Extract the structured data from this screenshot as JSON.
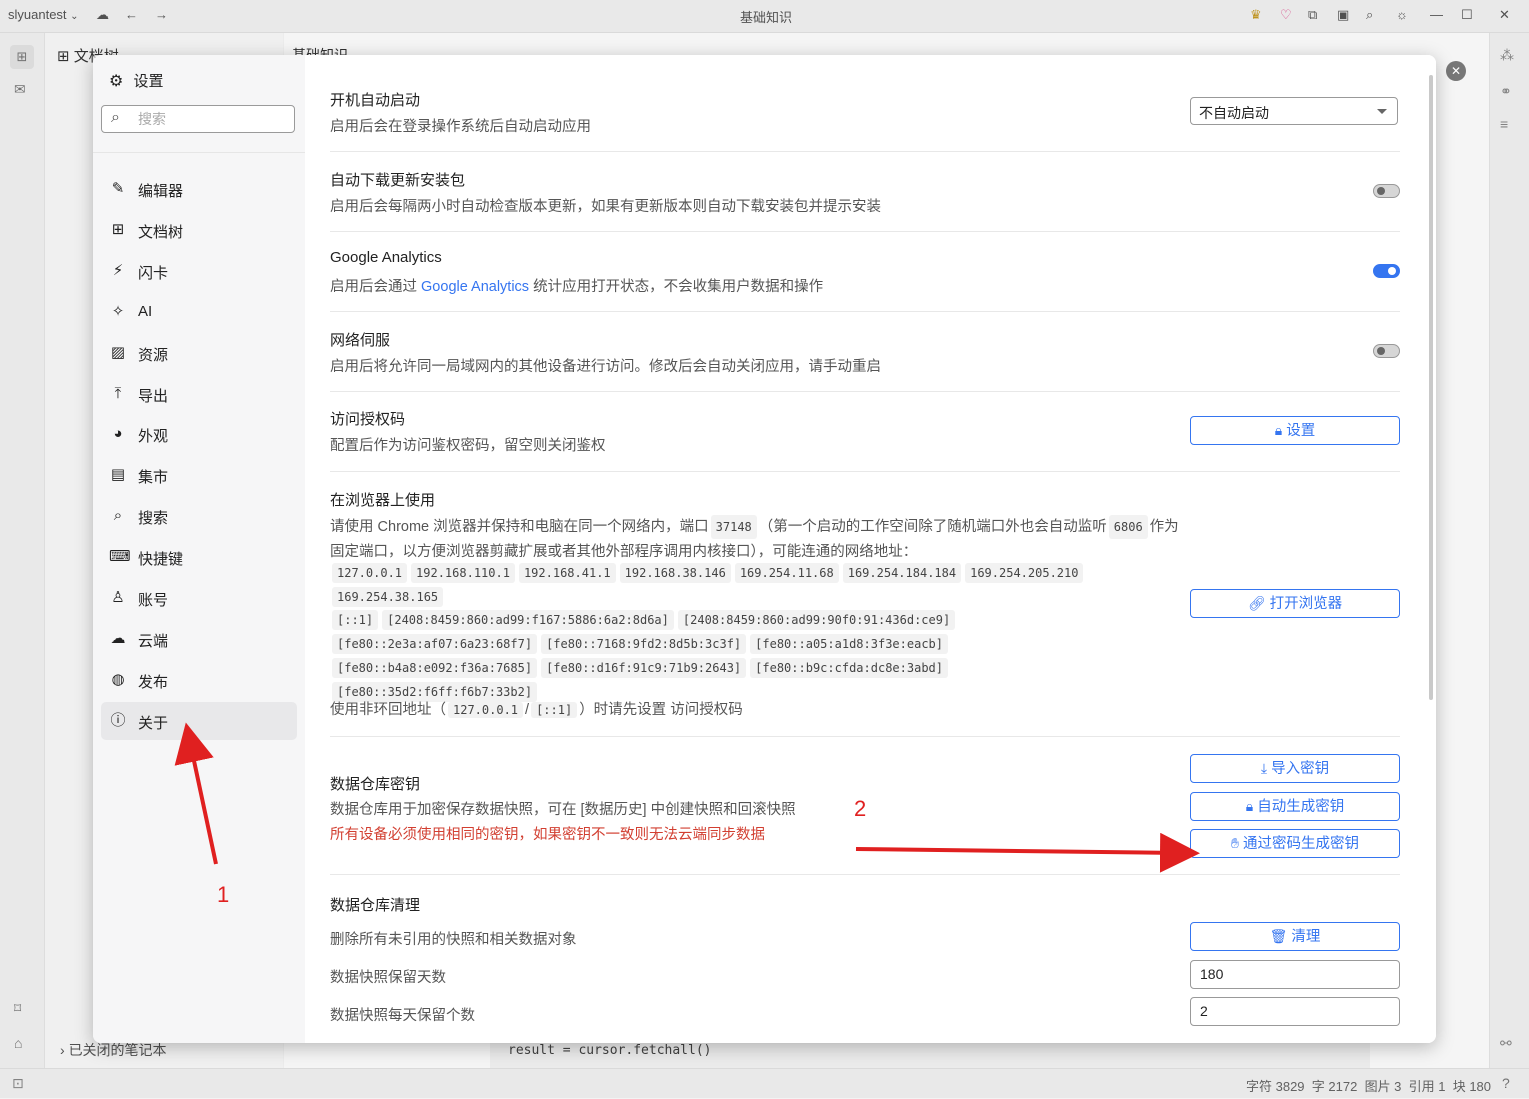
{
  "window": {
    "workspace": "slyuantest",
    "title": "基础知识"
  },
  "background": {
    "filetree_title": "文档树",
    "tab_label": "基础知识",
    "closed_notebooks": "已关闭的笔记本",
    "code_line": "result = cursor.fetchall()",
    "status": {
      "chars": "字符 3829",
      "words": "字 2172",
      "images": "图片 3",
      "refs": "引用 1",
      "blocks": "块 180"
    }
  },
  "settings": {
    "title": "设置",
    "search_placeholder": "搜索",
    "nav": [
      {
        "label": "编辑器",
        "icon": "pencil-icon"
      },
      {
        "label": "文档树",
        "icon": "tree-icon"
      },
      {
        "label": "闪卡",
        "icon": "lightning-icon"
      },
      {
        "label": "AI",
        "icon": "sparkle-icon"
      },
      {
        "label": "资源",
        "icon": "image-icon"
      },
      {
        "label": "导出",
        "icon": "upload-icon"
      },
      {
        "label": "外观",
        "icon": "palette-icon"
      },
      {
        "label": "集市",
        "icon": "store-icon"
      },
      {
        "label": "搜索",
        "icon": "search-icon"
      },
      {
        "label": "快捷键",
        "icon": "keyboard-icon"
      },
      {
        "label": "账号",
        "icon": "user-icon"
      },
      {
        "label": "云端",
        "icon": "cloud-icon"
      },
      {
        "label": "发布",
        "icon": "globe-icon"
      },
      {
        "label": "关于",
        "icon": "info-icon"
      }
    ],
    "active_nav": "关于"
  },
  "about": {
    "autostart": {
      "title": "开机自动启动",
      "desc": "启用后会在登录操作系统后自动启动应用",
      "value": "不自动启动"
    },
    "autodownload": {
      "title": "自动下载更新安装包",
      "desc": "启用后会每隔两小时自动检查版本更新，如果有更新版本则自动下载安装包并提示安装",
      "enabled": false
    },
    "analytics": {
      "title": "Google Analytics",
      "desc_prefix": "启用后会通过 ",
      "desc_link": "Google Analytics",
      "desc_suffix": " 统计应用打开状态，不会收集用户数据和操作",
      "enabled": true
    },
    "network": {
      "title": "网络伺服",
      "desc": "启用后将允许同一局域网内的其他设备进行访问。修改后会自动关闭应用，请手动重启",
      "enabled": false
    },
    "auth_code": {
      "title": "访问授权码",
      "desc": "配置后作为访问鉴权密码，留空则关闭鉴权",
      "button": "设置"
    },
    "browser": {
      "title": "在浏览器上使用",
      "desc_1": "请使用 Chrome 浏览器并保持和电脑在同一个网络内，端口",
      "port": "37148",
      "desc_2": "（第一个启动的工作空间除了随机端口外也会自动监听",
      "fixed_port": "6806",
      "desc_3": "作为固定端口，以方便浏览器剪藏扩展或者其他外部程序调用内核接口），可能连通的网络地址：",
      "ipv4": [
        "127.0.0.1",
        "192.168.110.1",
        "192.168.41.1",
        "192.168.38.146",
        "169.254.11.68",
        "169.254.184.184",
        "169.254.205.210",
        "169.254.38.165"
      ],
      "ipv6": [
        "[::1]",
        "[2408:8459:860:ad99:f167:5886:6a2:8d6a]",
        "[2408:8459:860:ad99:90f0:91:436d:ce9]",
        "[fe80::2e3a:af07:6a23:68f7]",
        "[fe80::7168:9fd2:8d5b:3c3f]",
        "[fe80::a05:a1d8:3f3e:eacb]",
        "[fe80::b4a8:e092:f36a:7685]",
        "[fe80::d16f:91c9:71b9:2643]",
        "[fe80::b9c:cfda:dc8e:3abd]",
        "[fe80::35d2:f6ff:f6b7:33b2]"
      ],
      "note_prefix": "使用非环回地址（",
      "note_addr1": "127.0.0.1",
      "note_sep": "/",
      "note_addr2": "[::1]",
      "note_suffix": "）时请先设置 访问授权码",
      "button": "打开浏览器"
    },
    "repo_key": {
      "title": "数据仓库密钥",
      "desc": "数据仓库用于加密保存数据快照，可在 [数据历史] 中创建快照和回滚快照",
      "warning": "所有设备必须使用相同的密钥，如果密钥不一致则无法云端同步数据",
      "btn_import": "导入密钥",
      "btn_auto": "自动生成密钥",
      "btn_password": "通过密码生成密钥"
    },
    "repo_purge": {
      "title": "数据仓库清理",
      "desc": "删除所有未引用的快照和相关数据对象",
      "button": "清理",
      "keep_days_label": "数据快照保留天数",
      "keep_days": "180",
      "keep_per_day_label": "数据快照每天保留个数",
      "keep_per_day": "2"
    }
  },
  "annotations": {
    "one": "1",
    "two": "2",
    "color": "#e02020"
  }
}
